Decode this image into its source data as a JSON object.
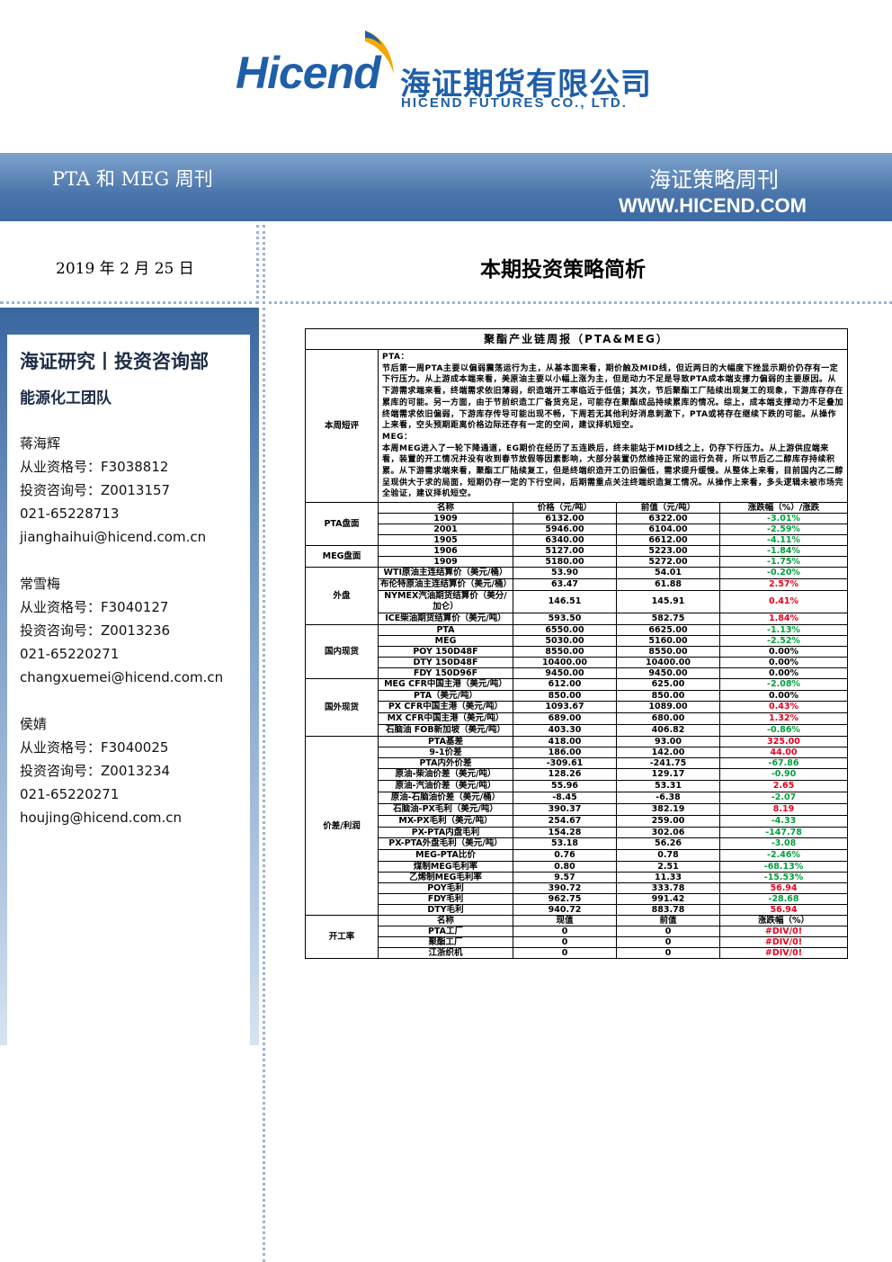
{
  "header": {
    "logo_en": "Hicend",
    "logo_cn": "海证期货有限公司",
    "logo_sub": "HICEND FUTURES CO., LTD.",
    "report_name": "PTA 和 MEG 周刊",
    "series": "海证策略周刊",
    "url": "WWW.HICEND.COM",
    "date": "2019 年 2 月 25 日",
    "main_title": "本期投资策略简析"
  },
  "sidebar": {
    "dept": "海证研究丨投资咨询部",
    "team": "能源化工团队",
    "analysts": [
      {
        "name": "蒋海辉",
        "qual": "从业资格号：F3038812",
        "consult": "投资咨询号：Z0013157",
        "phone": "021-65228713",
        "email": "jianghaihui@hicend.com.cn"
      },
      {
        "name": "常雪梅",
        "qual": "从业资格号：F3040127",
        "consult": "投资咨询号：Z0013236",
        "phone": "021-65220271",
        "email": "changxuemei@hicend.com.cn"
      },
      {
        "name": "侯婧",
        "qual": "从业资格号：F3040025",
        "consult": "投资咨询号：Z0013234",
        "phone": "021-65220271",
        "email": "houjing@hicend.com.cn"
      }
    ]
  },
  "table": {
    "title": "聚酯产业链周报（PTA&MEG）",
    "comment_label": "本周短评",
    "comment": "PTA：\n节后第一周PTA主要以偏弱震荡运行为主，从基本面来看，期价触及MID线，但近两日的大幅度下挫显示期价仍存有一定下行压力。从上游成本端来看，美原油主要以小幅上涨为主，但是动力不足是导致PTA成本端支撑力偏弱的主要原因。从下游需求端来看，终端需求依旧薄弱，织造端开工率临近于低值；其次，节后聚酯工厂陆续出现复工的现象，下游库存存在累库的可能。另一方面，由于节前织造工厂备货充足，可能存在聚酯成品持续累库的情况。综上，成本端支撑动力不足叠加终端需求依旧偏弱，下游库存传导可能出现不畅，下周若无其他利好消息刺激下，PTA或将存在继续下跌的可能。从操作上来看，空头预期距离价格边际还存有一定的空间，建议择机短空。\nMEG：\n本周MEG进入了一轮下降通道，EG期价在经历了五连跌后，终未能站于MID线之上，仍存下行压力。从上游供应端来看，装置的开工情况并没有收到春节放假等因素影响，大部分装置仍然维持正常的运行负荷，所以节后乙二醇库存持续积累。从下游需求端来看，聚酯工厂陆续复工，但是终端织造开工仍旧偏低，需求提升缓慢。从整体上来看，目前国内乙二醇呈现供大于求的局面，短期仍存一定的下行空间，后期需重点关注终端织造复工情况。从操作上来看，多头逻辑未被市场完全验证，建议择机短空。",
    "headers": {
      "name": "名称",
      "price": "价格（元/吨）",
      "prev": "前值（元/吨）",
      "chg": "涨跌幅（%）/涨跌"
    },
    "sections": [
      {
        "label": "PTA盘面",
        "rows": [
          {
            "name": "1909",
            "price": "6132.00",
            "prev": "6322.00",
            "chg": "-3.01%",
            "dir": "down"
          },
          {
            "name": "2001",
            "price": "5946.00",
            "prev": "6104.00",
            "chg": "-2.59%",
            "dir": "down"
          },
          {
            "name": "1905",
            "price": "6340.00",
            "prev": "6612.00",
            "chg": "-4.11%",
            "dir": "down"
          }
        ]
      },
      {
        "label": "MEG盘面",
        "rows": [
          {
            "name": "1906",
            "price": "5127.00",
            "prev": "5223.00",
            "chg": "-1.84%",
            "dir": "down"
          },
          {
            "name": "1909",
            "price": "5180.00",
            "prev": "5272.00",
            "chg": "-1.75%",
            "dir": "down"
          }
        ]
      },
      {
        "label": "外盘",
        "rows": [
          {
            "name": "WTI原油主连结算价（美元/桶）",
            "price": "53.90",
            "prev": "54.01",
            "chg": "-0.20%",
            "dir": "down",
            "tall": true
          },
          {
            "name": "布伦特原油主连结算价（美元/桶）",
            "price": "63.47",
            "prev": "61.88",
            "chg": "2.57%",
            "dir": "up",
            "tall": true
          },
          {
            "name": "NYMEX汽油期货结算价（美分/加仑）",
            "price": "146.51",
            "prev": "145.91",
            "chg": "0.41%",
            "dir": "up",
            "tall": true
          },
          {
            "name": "ICE柴油期货结算价（美元/吨）",
            "price": "593.50",
            "prev": "582.75",
            "chg": "1.84%",
            "dir": "up",
            "tall": true
          }
        ]
      },
      {
        "label": "国内现货",
        "rows": [
          {
            "name": "PTA",
            "price": "6550.00",
            "prev": "6625.00",
            "chg": "-1.13%",
            "dir": "down"
          },
          {
            "name": "MEG",
            "price": "5030.00",
            "prev": "5160.00",
            "chg": "-2.52%",
            "dir": "down"
          },
          {
            "name": "POY 150D48F",
            "price": "8550.00",
            "prev": "8550.00",
            "chg": "0.00%",
            "dir": "flat"
          },
          {
            "name": "DTY 150D48F",
            "price": "10400.00",
            "prev": "10400.00",
            "chg": "0.00%",
            "dir": "flat"
          },
          {
            "name": "FDY 150D96F",
            "price": "9450.00",
            "prev": "9450.00",
            "chg": "0.00%",
            "dir": "flat"
          }
        ]
      },
      {
        "label": "国外现货",
        "rows": [
          {
            "name": "MEG CFR中国主港（美元/吨）",
            "price": "612.00",
            "prev": "625.00",
            "chg": "-2.08%",
            "dir": "down",
            "tall": true
          },
          {
            "name": "PTA（美元/吨）",
            "price": "850.00",
            "prev": "850.00",
            "chg": "0.00%",
            "dir": "flat"
          },
          {
            "name": "PX CFR中国主港（美元/吨）",
            "price": "1093.67",
            "prev": "1089.00",
            "chg": "0.43%",
            "dir": "up",
            "tall": true
          },
          {
            "name": "MX CFR中国主港（美元/吨）",
            "price": "689.00",
            "prev": "680.00",
            "chg": "1.32%",
            "dir": "up",
            "tall": true
          },
          {
            "name": "石脑油 FOB新加坡（美元/吨）",
            "price": "403.30",
            "prev": "406.82",
            "chg": "-0.86%",
            "dir": "down",
            "tall": true
          }
        ]
      },
      {
        "label": "价差/利润",
        "rows": [
          {
            "name": "PTA基差",
            "price": "418.00",
            "prev": "93.00",
            "chg": "325.00",
            "dir": "up"
          },
          {
            "name": "9-1价差",
            "price": "186.00",
            "prev": "142.00",
            "chg": "44.00",
            "dir": "up"
          },
          {
            "name": "PTA内外价差",
            "price": "-309.61",
            "prev": "-241.75",
            "chg": "-67.86",
            "dir": "down"
          },
          {
            "name": "原油-柴油价差（美元/吨）",
            "price": "128.26",
            "prev": "129.17",
            "chg": "-0.90",
            "dir": "down",
            "tall": true
          },
          {
            "name": "原油-汽油价差（美元/吨）",
            "price": "55.96",
            "prev": "53.31",
            "chg": "2.65",
            "dir": "up",
            "tall": true
          },
          {
            "name": "原油-石脑油价差（美元/桶）",
            "price": "-8.45",
            "prev": "-6.38",
            "chg": "-2.07",
            "dir": "down",
            "tall": true
          },
          {
            "name": "石脑油-PX毛利（美元/吨）",
            "price": "390.37",
            "prev": "382.19",
            "chg": "8.19",
            "dir": "up",
            "tall": true
          },
          {
            "name": "MX-PX毛利（美元/吨）",
            "price": "254.67",
            "prev": "259.00",
            "chg": "-4.33",
            "dir": "down",
            "tall": true
          },
          {
            "name": "PX-PTA内盘毛利",
            "price": "154.28",
            "prev": "302.06",
            "chg": "-147.78",
            "dir": "down"
          },
          {
            "name": "PX-PTA外盘毛利（美元/吨）",
            "price": "53.18",
            "prev": "56.26",
            "chg": "-3.08",
            "dir": "down",
            "tall": true
          },
          {
            "name": "MEG-PTA比价",
            "price": "0.76",
            "prev": "0.78",
            "chg": "-2.46%",
            "dir": "down",
            "tall": true
          },
          {
            "name": "煤制MEG毛利率",
            "price": "0.80",
            "prev": "2.51",
            "chg": "-68.13%",
            "dir": "down"
          },
          {
            "name": "乙烯制MEG毛利率",
            "price": "9.57",
            "prev": "11.33",
            "chg": "-15.53%",
            "dir": "down"
          },
          {
            "name": "POY毛利",
            "price": "390.72",
            "prev": "333.78",
            "chg": "56.94",
            "dir": "up"
          },
          {
            "name": "FDY毛利",
            "price": "962.75",
            "prev": "991.42",
            "chg": "-28.68",
            "dir": "down"
          },
          {
            "name": "DTY毛利",
            "price": "940.72",
            "prev": "883.78",
            "chg": "56.94",
            "dir": "up"
          }
        ]
      },
      {
        "label": "开工率",
        "rows": [
          {
            "name": "名称",
            "price": "现值",
            "prev": "前值",
            "chg": "涨跌幅（%）",
            "dir": "flat"
          },
          {
            "name": "PTA工厂",
            "price": "0",
            "prev": "0",
            "chg": "#DIV/0!",
            "dir": "up"
          },
          {
            "name": "聚酯工厂",
            "price": "0",
            "prev": "0",
            "chg": "#DIV/0!",
            "dir": "up"
          },
          {
            "name": "江浙织机",
            "price": "0",
            "prev": "0",
            "chg": "#DIV/0!",
            "dir": "up"
          }
        ]
      }
    ]
  }
}
